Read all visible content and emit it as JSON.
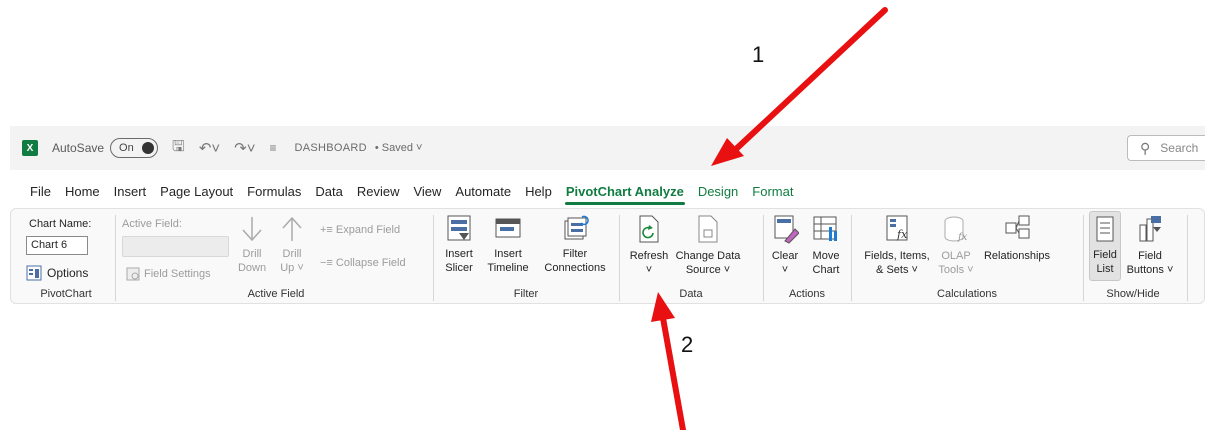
{
  "annotations": {
    "label_1": "1",
    "label_2": "2"
  },
  "titlebar": {
    "autosave_label": "AutoSave",
    "autosave_state": "On",
    "filename": "DASHBOARD",
    "status": "• Saved",
    "search_placeholder": "Search"
  },
  "tabs": [
    "File",
    "Home",
    "Insert",
    "Page Layout",
    "Formulas",
    "Data",
    "Review",
    "View",
    "Automate",
    "Help",
    "PivotChart Analyze",
    "Design",
    "Format"
  ],
  "ribbon": {
    "pivotchart": {
      "chart_name_label": "Chart Name:",
      "chart_name_value": "Chart 6",
      "options": "Options",
      "group": "PivotChart"
    },
    "active_field": {
      "label": "Active Field:",
      "field_settings": "Field Settings",
      "drill_down_1": "Drill",
      "drill_down_2": "Down",
      "drill_up_1": "Drill",
      "drill_up_2": "Up ˅",
      "expand": "Expand Field",
      "collapse": "Collapse Field",
      "group": "Active Field"
    },
    "filter": {
      "slicer_1": "Insert",
      "slicer_2": "Slicer",
      "timeline_1": "Insert",
      "timeline_2": "Timeline",
      "conn_1": "Filter",
      "conn_2": "Connections",
      "group": "Filter"
    },
    "data": {
      "refresh_1": "Refresh",
      "refresh_2": "˅",
      "change_1": "Change Data",
      "change_2": "Source ˅",
      "group": "Data"
    },
    "actions": {
      "clear_1": "Clear",
      "clear_2": "˅",
      "move_1": "Move",
      "move_2": "Chart",
      "group": "Actions"
    },
    "calculations": {
      "fields_1": "Fields, Items,",
      "fields_2": "& Sets ˅",
      "olap_1": "OLAP",
      "olap_2": "Tools ˅",
      "relationships": "Relationships",
      "group": "Calculations"
    },
    "showhide": {
      "fieldlist_1": "Field",
      "fieldlist_2": "List",
      "buttons_1": "Field",
      "buttons_2": "Buttons ˅",
      "group": "Show/Hide"
    }
  },
  "colors": {
    "accent": "#107c41",
    "arrow": "#e81010"
  }
}
